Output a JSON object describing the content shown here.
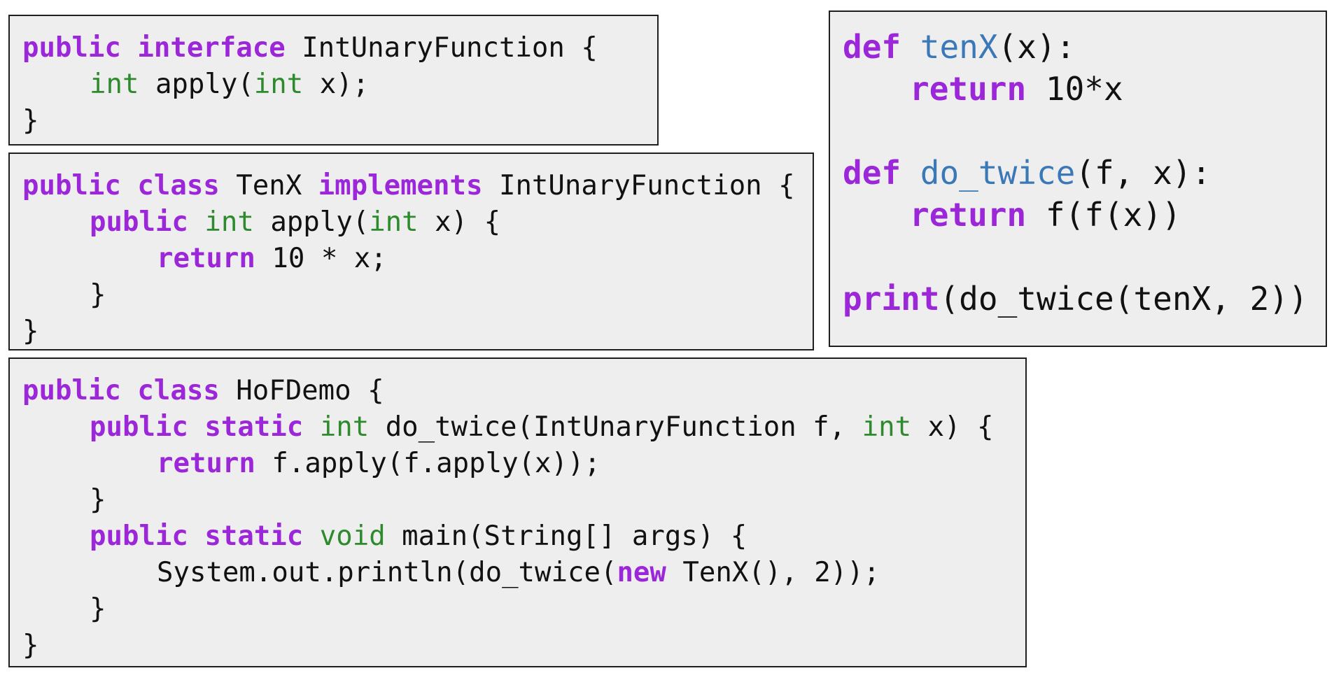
{
  "colors": {
    "keyword": "#9b27d8",
    "type": "#2d8a2d",
    "function_name": "#3a78b8",
    "text": "#111111",
    "box_background": "#eeeeee",
    "box_border": "#1f1f1f"
  },
  "interface_box": {
    "l1": {
      "k1": "public",
      "k2": "interface",
      "t": "IntUnaryFunction {"
    },
    "l2": {
      "ty1": "int",
      "t1": "apply(",
      "ty2": "int",
      "t2": "x);"
    },
    "l3": {
      "t": "}"
    }
  },
  "tenx_box": {
    "l1": {
      "k1": "public",
      "k2": "class",
      "t1": "TenX",
      "k3": "implements",
      "t2": "IntUnaryFunction {"
    },
    "l2": {
      "k1": "public",
      "ty1": "int",
      "t1": "apply(",
      "ty2": "int",
      "t2": "x) {"
    },
    "l3": {
      "k1": "return",
      "t": "10 * x;"
    },
    "l4": {
      "t": "}"
    },
    "l5": {
      "t": "}"
    }
  },
  "hof_box": {
    "l1": {
      "k1": "public",
      "k2": "class",
      "t": "HoFDemo {"
    },
    "l2": {
      "k1": "public",
      "k2": "static",
      "ty1": "int",
      "t1": "do_twice(IntUnaryFunction f,",
      "ty2": "int",
      "t2": "x) {"
    },
    "l3": {
      "k1": "return",
      "t": "f.apply(f.apply(x));"
    },
    "l4": {
      "t": "}"
    },
    "l5": {
      "k1": "public",
      "k2": "static",
      "ty1": "void",
      "t": "main(String[] args) {"
    },
    "l6": {
      "t1": "System.out.println(do_twice(",
      "k1": "new",
      "t2": "TenX(), 2));"
    },
    "l7": {
      "t": "}"
    },
    "l8": {
      "t": "}"
    }
  },
  "python_box": {
    "l1": {
      "k1": "def",
      "f1": "tenX",
      "t": "(x):"
    },
    "l2": {
      "k1": "return",
      "t": "10*x"
    },
    "l3": {
      "k1": "def",
      "f1": "do_twice",
      "t": "(f, x):"
    },
    "l4": {
      "k1": "return",
      "t": "f(f(x))"
    },
    "l5": {
      "k1": "print",
      "t": "(do_twice(tenX, 2))"
    }
  }
}
